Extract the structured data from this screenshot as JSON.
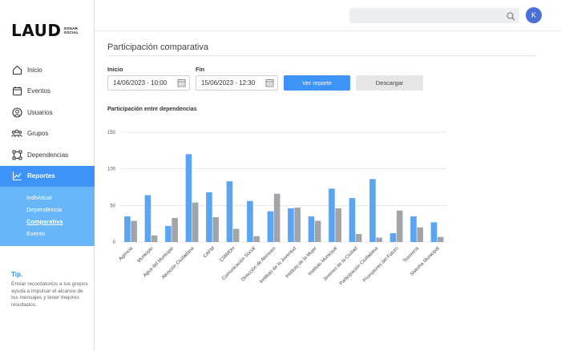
{
  "app": {
    "logo": "LAUD",
    "logo_sub": [
      "SONAR",
      "SOCIAL"
    ]
  },
  "sidebar": {
    "items": [
      {
        "label": "Inicio",
        "icon": "home-icon"
      },
      {
        "label": "Eventos",
        "icon": "calendar-icon"
      },
      {
        "label": "Usuarios",
        "icon": "user-icon"
      },
      {
        "label": "Grupos",
        "icon": "group-icon"
      },
      {
        "label": "Dependencias",
        "icon": "network-icon"
      },
      {
        "label": "Reportes",
        "icon": "chart-icon",
        "active": true
      }
    ],
    "subitems": [
      "Individual",
      "Dependencia",
      "Comparativa",
      "Evento"
    ],
    "current_subitem": "Comparativa"
  },
  "tip": {
    "title": "Tip.",
    "text": "Enviar recordatorios a tus grupos ayuda a impulsar el alcance de tus mensajes y tener mejores resultados."
  },
  "header": {
    "search_placeholder": "",
    "avatar_initial": "K"
  },
  "page": {
    "title": "Participación comparativa",
    "start_label": "Inicio",
    "start_value": "14/06/2023 - 10:00",
    "end_label": "Fin",
    "end_value": "15/06/2023 - 12:30",
    "view_button": "Ver reporte",
    "download_button": "Descargar",
    "chart_title": "Participación entre dependencias"
  },
  "colors": {
    "accent": "#3d94f6",
    "series_a": "#5aa5f3",
    "series_b": "#a1a4a9",
    "subnav": "#66b6f8"
  },
  "chart_data": {
    "type": "bar",
    "categories": [
      "Agencia",
      "Municipio",
      "Agua del Municipio",
      "Atención Ciudadana",
      "CAFM",
      "CIAMDH",
      "Comunicación Social",
      "Dirección de Atención",
      "Instituto de la Juventud",
      "Instituto de la Mujer",
      "Instituto Municipal",
      "Jóvenes de la Ciudad",
      "Participación Ciudadana",
      "Promotores del Futuro",
      "Tesorería",
      "Sistema Municipal"
    ],
    "series": [
      {
        "values": [
          35,
          64,
          22,
          120,
          68,
          83,
          56,
          42,
          46,
          35,
          73,
          60,
          86,
          12,
          35,
          27
        ]
      },
      {
        "values": [
          29,
          9,
          33,
          54,
          34,
          18,
          8,
          66,
          47,
          29,
          46,
          11,
          6,
          43,
          20,
          7
        ]
      }
    ],
    "yticks": [
      0,
      50,
      100,
      150
    ],
    "ylim": [
      0,
      150
    ],
    "grid": true
  }
}
